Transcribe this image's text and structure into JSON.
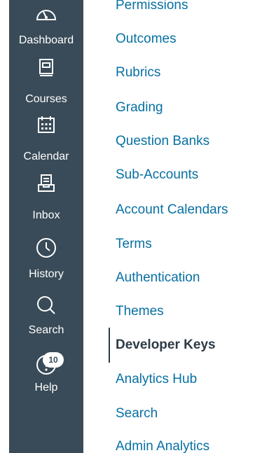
{
  "global_nav": {
    "items": [
      {
        "label": "Dashboard",
        "icon": "dashboard-icon"
      },
      {
        "label": "Courses",
        "icon": "courses-icon"
      },
      {
        "label": "Calendar",
        "icon": "calendar-icon"
      },
      {
        "label": "Inbox",
        "icon": "inbox-icon"
      },
      {
        "label": "History",
        "icon": "history-icon"
      },
      {
        "label": "Search",
        "icon": "search-icon"
      },
      {
        "label": "Help",
        "icon": "help-icon",
        "badge": "10"
      }
    ]
  },
  "admin_nav": {
    "items": [
      {
        "label": "Permissions"
      },
      {
        "label": "Outcomes"
      },
      {
        "label": "Rubrics"
      },
      {
        "label": "Grading"
      },
      {
        "label": "Question Banks"
      },
      {
        "label": "Sub-Accounts"
      },
      {
        "label": "Account Calendars"
      },
      {
        "label": "Terms"
      },
      {
        "label": "Authentication"
      },
      {
        "label": "Themes"
      },
      {
        "label": "Developer Keys",
        "active": true
      },
      {
        "label": "Analytics Hub"
      },
      {
        "label": "Search"
      },
      {
        "label": "Admin Analytics"
      }
    ]
  },
  "colors": {
    "nav_background": "#394b58",
    "link": "#0770a3",
    "active_text": "#2d3b45"
  }
}
